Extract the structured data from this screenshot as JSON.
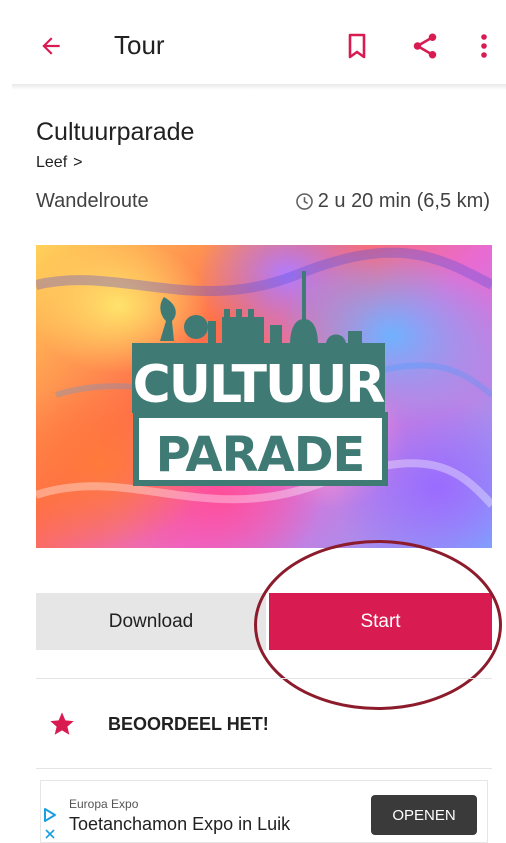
{
  "appbar": {
    "title": "Tour",
    "back_icon": "arrow-left-icon",
    "actions": [
      "bookmark-icon",
      "share-icon",
      "more-vert-icon"
    ],
    "accent": "#d81b50"
  },
  "tour": {
    "title": "Cultuurparade",
    "category": "Leef",
    "category_chevron": ">",
    "type": "Wandelroute",
    "duration": "2 u 20 min (6,5 km)"
  },
  "hero": {
    "logo_line1": "CULTUUR",
    "logo_line2": "PARADE"
  },
  "actions": {
    "download_label": "Download",
    "start_label": "Start"
  },
  "rating": {
    "label": "BEOORDEEL HET!",
    "icon": "star-icon"
  },
  "ad": {
    "source": "Europa Expo",
    "title": "Toetanchamon Expo in Luik",
    "cta": "OPENEN"
  }
}
